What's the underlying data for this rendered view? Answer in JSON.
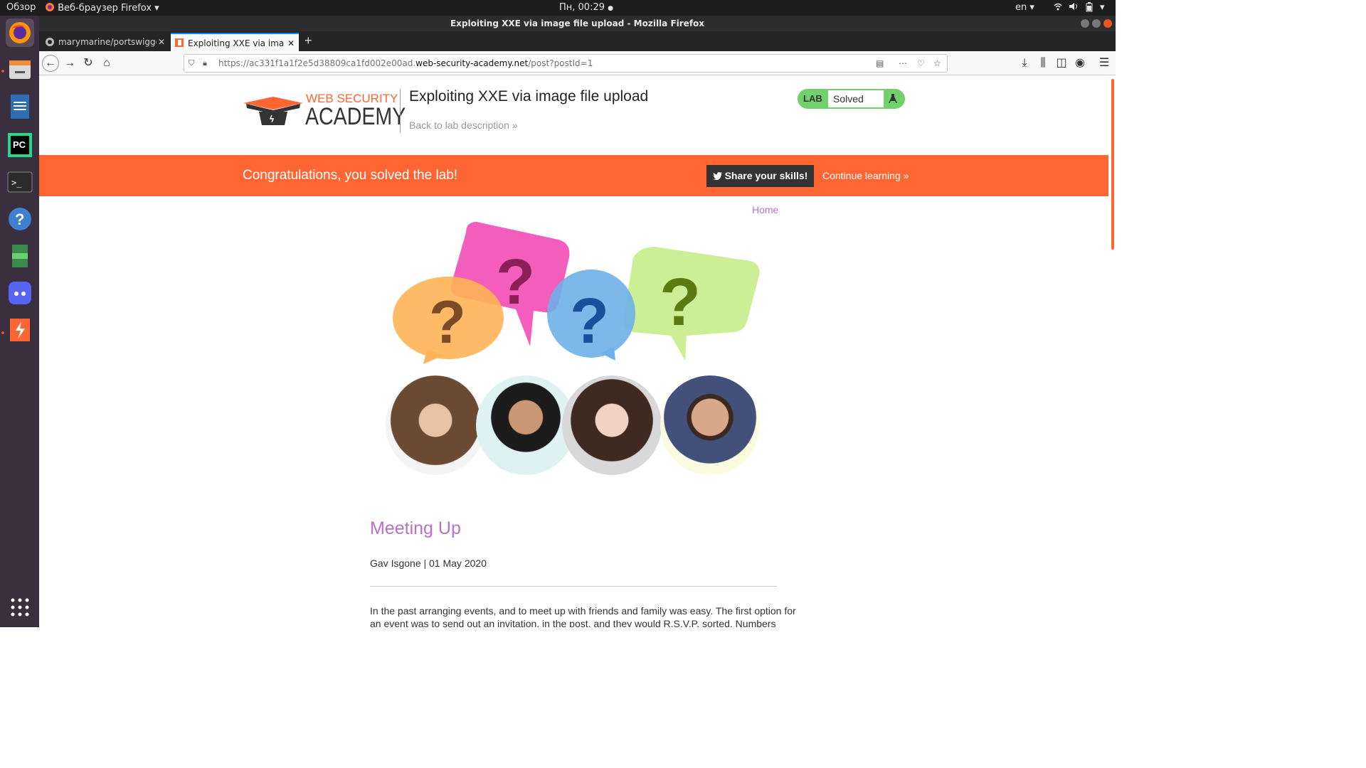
{
  "os": {
    "activities": "Обзор",
    "app_menu": "Веб-браузер Firefox",
    "clock": "Пн, 00:29",
    "lang": "en"
  },
  "window": {
    "title": "Exploiting XXE via image file upload - Mozilla Firefox"
  },
  "tabs": [
    {
      "label": "marymarine/portswigger"
    },
    {
      "label": "Exploiting XXE via image file upload"
    }
  ],
  "url": {
    "prefix": "https://ac331f1a1f2e5d38809ca1fd002e00ad.",
    "domain": "web-security-academy.net",
    "path": "/post?postId=1"
  },
  "header": {
    "logo_top": "WEB SECURITY",
    "logo_bottom": "ACADEMY",
    "title": "Exploiting XXE via image file upload",
    "back_link": "Back to lab description",
    "lab_badge": "LAB",
    "lab_status": "Solved"
  },
  "banner": {
    "message": "Congratulations, you solved the lab!",
    "share": "Share your skills!",
    "continue": "Continue learning"
  },
  "nav": {
    "home": "Home"
  },
  "post": {
    "title": "Meeting Up",
    "author": "Gav Isgone | 01 May 2020",
    "body1": "In the past arranging events, and to meet up with friends and family was easy. The first option for",
    "body2": "an event was to send out an invitation, in the post, and they would R.S.V.P. sorted. Numbers"
  },
  "colors": {
    "accent": "#ff6633",
    "link": "#b970c9",
    "lab_green": "#70d16d"
  }
}
